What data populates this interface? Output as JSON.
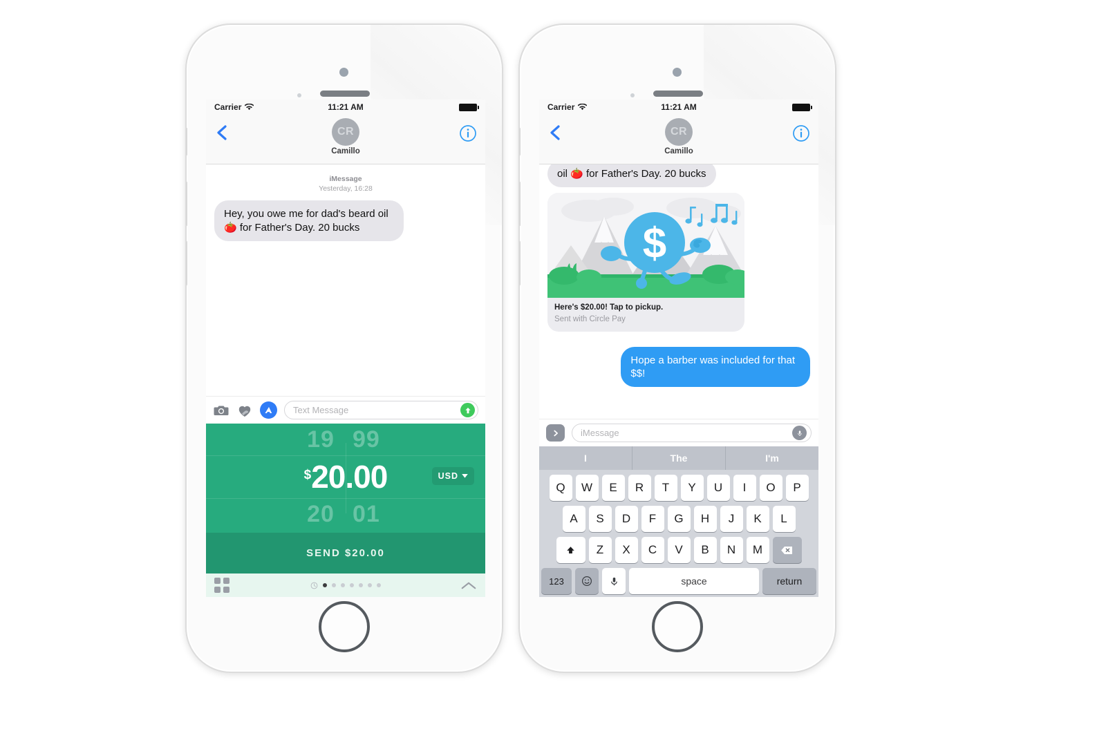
{
  "status_bar": {
    "carrier": "Carrier",
    "time": "11:21 AM",
    "wifi_icon": "wifi-icon",
    "battery_icon": "battery-full-icon"
  },
  "nav_bar": {
    "back_icon": "chevron-left-icon",
    "avatar_initials": "CR",
    "contact_name": "Camillo",
    "info_icon": "info-circle-icon"
  },
  "left_phone": {
    "thread": {
      "service_label": "iMessage",
      "timestamp": "Yesterday, 16:28",
      "messages": [
        {
          "direction": "received",
          "text": "Hey, you owe me for dad's beard oil 🍅 for Father's Day. 20 bucks"
        }
      ]
    },
    "compose": {
      "camera_icon": "camera-icon",
      "digital_touch_icon": "heart-hand-icon",
      "app_store_icon": "app-store-icon",
      "placeholder": "Text Message",
      "send_icon": "send-arrow-up-icon"
    },
    "payment_app": {
      "picker": {
        "ghost_above_whole": "19",
        "ghost_above_cents": "99",
        "currency_symbol": "$",
        "amount_whole": "20",
        "amount_separator": ".",
        "amount_cents": "00",
        "ghost_below_whole": "20",
        "ghost_below_cents": "01",
        "currency_code": "USD",
        "currency_dropdown_icon": "chevron-down-icon"
      },
      "send_button_label": "SEND $20.00",
      "drawer": {
        "grid_icon": "app-grid-icon",
        "recents_icon": "recents-clock-icon",
        "page_count": 7,
        "active_page": 1,
        "expand_icon": "chevron-up-icon"
      }
    },
    "colors": {
      "picker_green": "#27ab7e",
      "send_green": "#229670",
      "drawer_mint": "#e7f6ef"
    }
  },
  "right_phone": {
    "thread": {
      "messages": [
        {
          "direction": "received",
          "text": "oil 🍅 for Father's Day. 20 bucks",
          "clipped": true
        },
        {
          "direction": "received",
          "type": "payment_card",
          "caption_main": "Here's $20.00! Tap to pickup.",
          "caption_sub": "Sent with Circle Pay",
          "art": {
            "description": "blue dollar coin character walking through mountains",
            "dollar_symbol": "$",
            "music_notes_icon": "music-notes-icon"
          }
        },
        {
          "direction": "sent",
          "text": "Hope a barber was included for that $$!"
        }
      ]
    },
    "compose": {
      "expand_icon": "chevron-right-icon",
      "placeholder": "iMessage",
      "mic_icon": "microphone-icon"
    },
    "keyboard": {
      "predictions": [
        "I",
        "The",
        "I'm"
      ],
      "row1": [
        "Q",
        "W",
        "E",
        "R",
        "T",
        "Y",
        "U",
        "I",
        "O",
        "P"
      ],
      "row2": [
        "A",
        "S",
        "D",
        "F",
        "G",
        "H",
        "J",
        "K",
        "L"
      ],
      "row3": [
        "Z",
        "X",
        "C",
        "V",
        "B",
        "N",
        "M"
      ],
      "shift_icon": "shift-up-icon",
      "backspace_icon": "backspace-icon",
      "numbers_label": "123",
      "emoji_icon": "emoji-smile-icon",
      "dictation_icon": "microphone-icon",
      "space_label": "space",
      "return_label": "return"
    },
    "colors": {
      "sent_bubble_blue": "#2f9cf4",
      "keyboard_bg": "#d2d5db",
      "predict_bg": "#bfc3cb"
    }
  }
}
